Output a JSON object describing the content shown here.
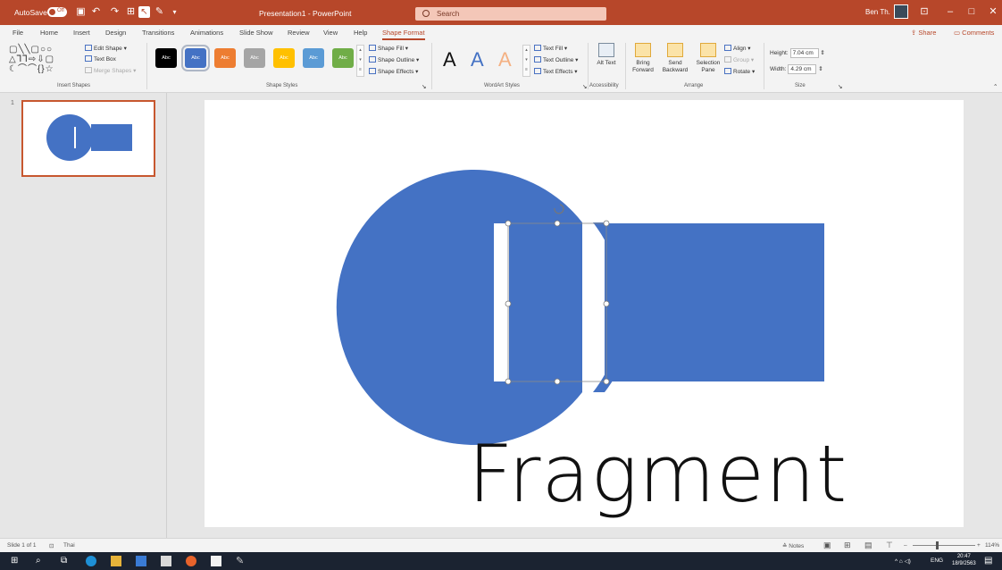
{
  "titlebar": {
    "autosave_label": "AutoSave",
    "autosave_state": "Off",
    "doc_title": "Presentation1 - PowerPoint",
    "search_placeholder": "Search",
    "user_name": "Ben Th."
  },
  "tabs": [
    "File",
    "Home",
    "Insert",
    "Design",
    "Transitions",
    "Animations",
    "Slide Show",
    "Review",
    "View",
    "Help",
    "Shape Format"
  ],
  "active_tab": "Shape Format",
  "share_label": "Share",
  "comments_label": "Comments",
  "ribbon": {
    "insert_shapes": {
      "edit_shape": "Edit Shape",
      "text_box": "Text Box",
      "merge_shapes": "Merge Shapes",
      "label": "Insert Shapes"
    },
    "shape_styles": {
      "swatch_text": "Abc",
      "swatches": [
        {
          "color": "#000000"
        },
        {
          "color": "#4472c4"
        },
        {
          "color": "#ed7d31"
        },
        {
          "color": "#a5a5a5"
        },
        {
          "color": "#ffc000"
        },
        {
          "color": "#5b9bd5"
        },
        {
          "color": "#70ad47"
        }
      ],
      "shape_fill": "Shape Fill",
      "shape_outline": "Shape Outline",
      "shape_effects": "Shape Effects",
      "label": "Shape Styles"
    },
    "wordart": {
      "letters": [
        "A",
        "A",
        "A"
      ],
      "text_fill": "Text Fill",
      "text_outline": "Text Outline",
      "text_effects": "Text Effects",
      "label": "WordArt Styles"
    },
    "accessibility": {
      "alt_text": "Alt Text",
      "label": "Accessibility"
    },
    "arrange": {
      "bring_forward": "Bring Forward",
      "send_backward": "Send Backward",
      "selection_pane": "Selection Pane",
      "align": "Align",
      "group": "Group",
      "rotate": "Rotate",
      "label": "Arrange"
    },
    "size": {
      "height_label": "Height:",
      "height_value": "7.04 cm",
      "width_label": "Width:",
      "width_value": "4.29 cm",
      "label": "Size"
    }
  },
  "slide_panel": {
    "slide_number": "1"
  },
  "statusbar": {
    "slide_info": "Slide 1 of 1",
    "language": "Thai",
    "notes": "Notes",
    "zoom": "114%"
  },
  "taskbar": {
    "language": "ENG",
    "time": "20:47",
    "date": "18/9/2563"
  },
  "overlay_caption": "Fragment",
  "colors": {
    "accent": "#b7472a",
    "shape_fill": "#4472c4"
  }
}
